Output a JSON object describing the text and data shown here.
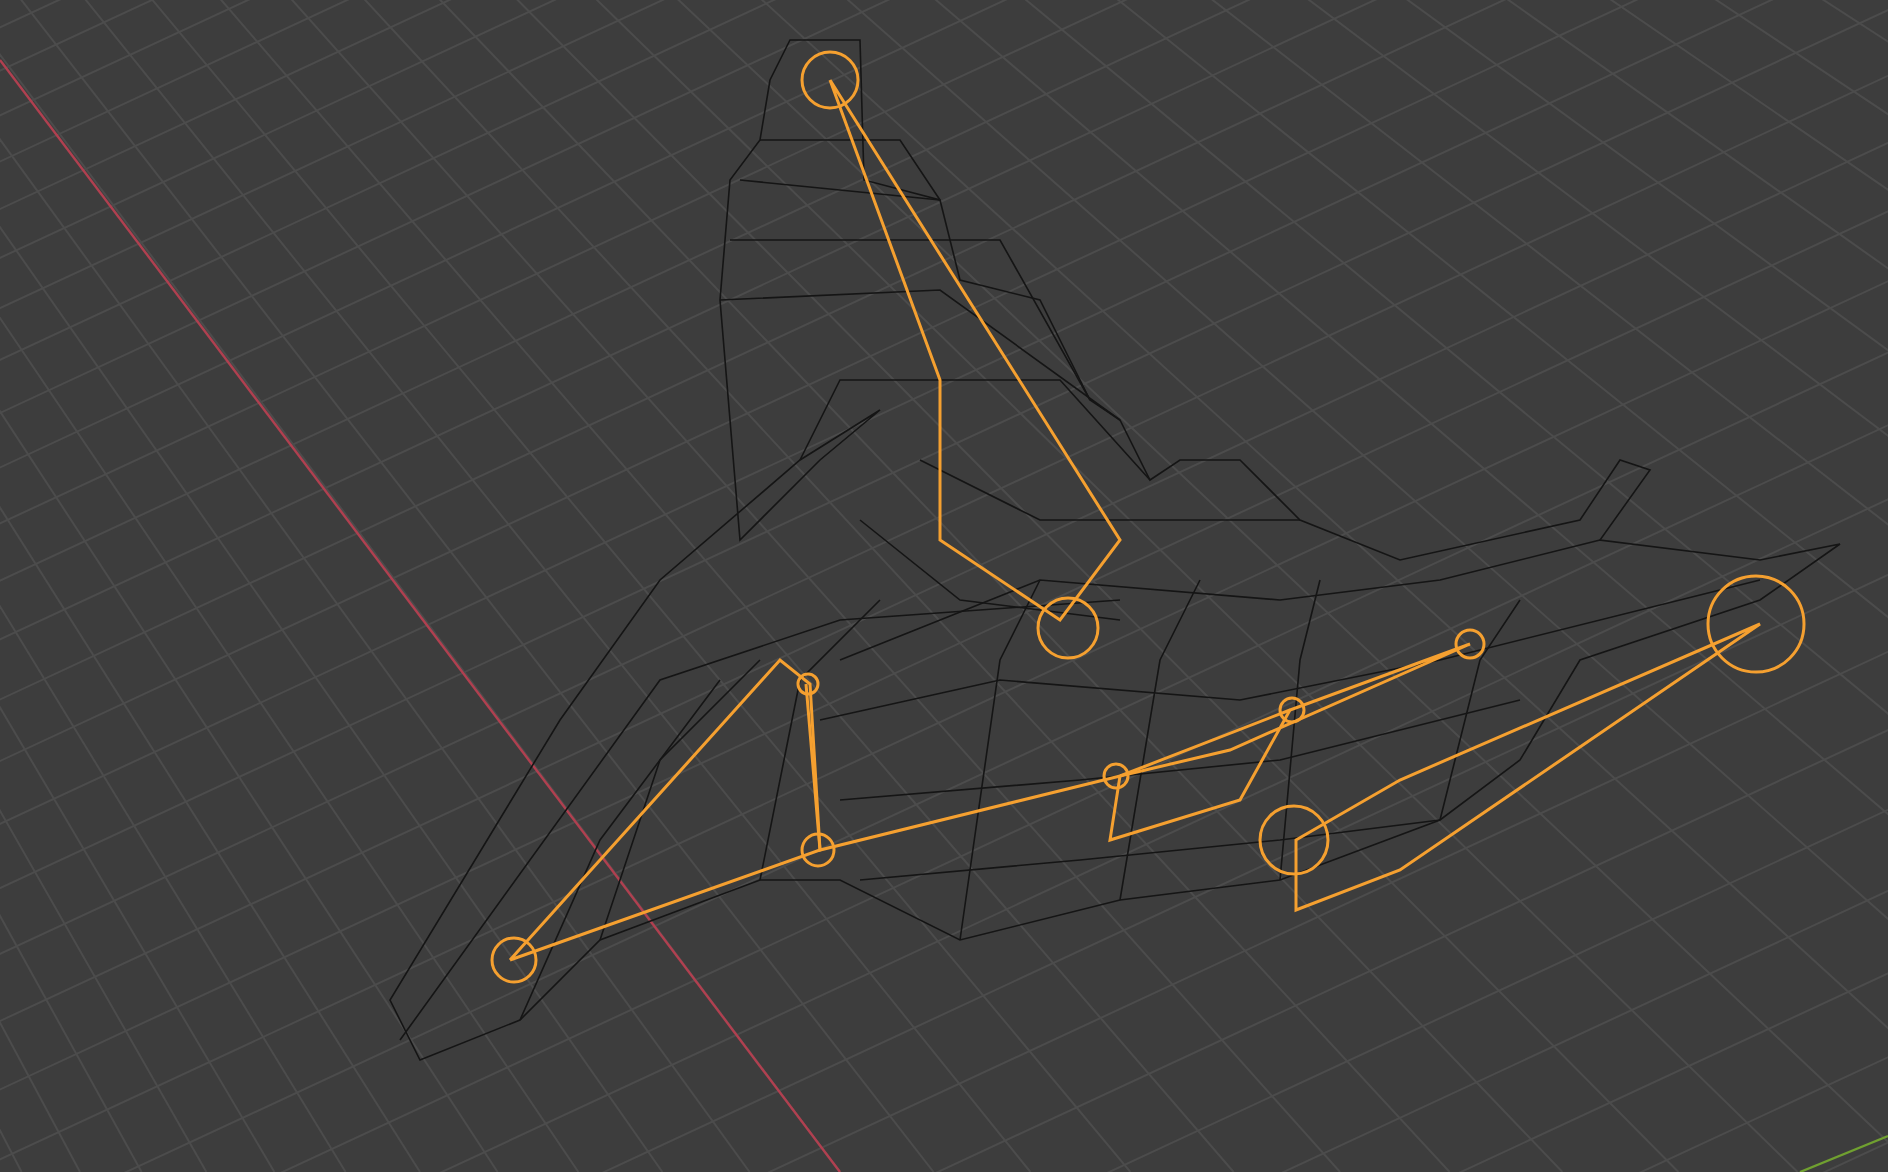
{
  "viewport": {
    "armature_selected": true
  }
}
